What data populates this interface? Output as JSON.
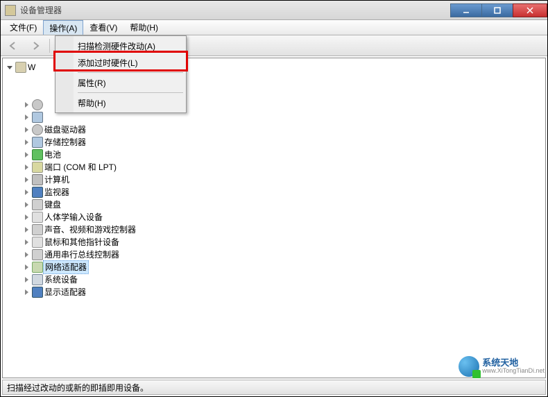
{
  "window": {
    "title": "设备管理器"
  },
  "menubar": {
    "file": "文件(F)",
    "action": "操作(A)",
    "view": "查看(V)",
    "help": "帮助(H)"
  },
  "context_menu": {
    "scan": "扫描检测硬件改动(A)",
    "add_legacy": "添加过时硬件(L)",
    "properties": "属性(R)",
    "help": "帮助(H)"
  },
  "tree": {
    "root_visible": "W",
    "items": [
      {
        "label": "磁盘驱动器",
        "icon": "dvd"
      },
      {
        "label": "存储控制器",
        "icon": "storage"
      },
      {
        "label": "电池",
        "icon": "battery"
      },
      {
        "label": "端口 (COM 和 LPT)",
        "icon": "port"
      },
      {
        "label": "计算机",
        "icon": "cpu"
      },
      {
        "label": "监视器",
        "icon": "monitor"
      },
      {
        "label": "键盘",
        "icon": "keyboard"
      },
      {
        "label": "人体学输入设备",
        "icon": "hid"
      },
      {
        "label": "声音、视频和游戏控制器",
        "icon": "sound"
      },
      {
        "label": "鼠标和其他指针设备",
        "icon": "mouse"
      },
      {
        "label": "通用串行总线控制器",
        "icon": "usb"
      },
      {
        "label": "网络适配器",
        "icon": "net",
        "selected": true
      },
      {
        "label": "系统设备",
        "icon": "system"
      },
      {
        "label": "显示适配器",
        "icon": "display"
      }
    ],
    "hidden_top": [
      {
        "icon": "dvd"
      },
      {
        "icon": "storage"
      },
      {
        "icon": "battery"
      },
      {
        "icon": "port"
      }
    ]
  },
  "statusbar": {
    "text": "扫描经过改动的或新的即插即用设备。"
  },
  "watermark": {
    "main": "系统天地",
    "sub": "www.XiTongTianDi.net"
  }
}
